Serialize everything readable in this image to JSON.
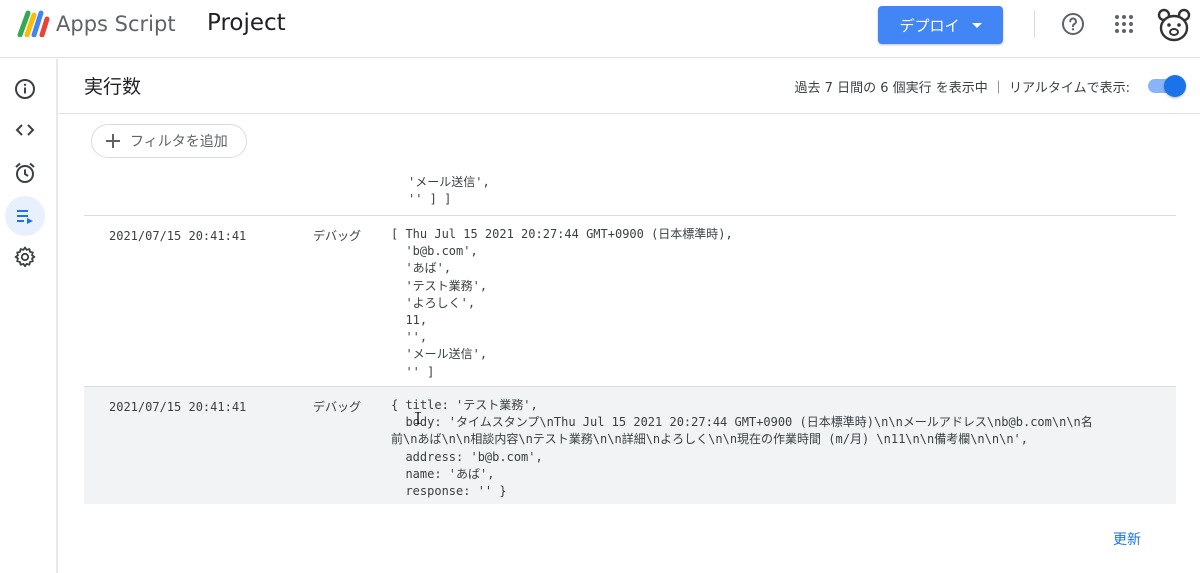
{
  "header": {
    "app_name": "Apps Script",
    "project_name": "Project",
    "deploy_label": "デプロイ",
    "icons": [
      "apps-script-logo",
      "help-icon",
      "apps-grid-icon",
      "account-avatar"
    ]
  },
  "sidebar": {
    "items": [
      {
        "name": "overview",
        "icon": "info-icon"
      },
      {
        "name": "editor",
        "icon": "code-icon"
      },
      {
        "name": "triggers",
        "icon": "alarm-clock-icon"
      },
      {
        "name": "executions",
        "icon": "executions-icon",
        "active": true
      },
      {
        "name": "settings",
        "icon": "gear-icon"
      }
    ]
  },
  "executions": {
    "title": "実行数",
    "summary": "過去 7 日間の 6 個実行 を表示中 ｜ リアルタイムで表示:",
    "realtime_on": true,
    "filter_label": "フィルタを追加",
    "refresh_label": "更新"
  },
  "logs": {
    "continuation": "'メール送信',\n'' ] ]",
    "entries": [
      {
        "time": "2021/07/15 20:41:41",
        "level": "デバッグ",
        "message": "[ Thu Jul 15 2021 20:27:44 GMT+0900 (日本標準時),\n  'b@b.com',\n  'あば',\n  'テスト業務',\n  'よろしく',\n  11,\n  '',\n  'メール送信',\n  '' ]"
      },
      {
        "time": "2021/07/15 20:41:41",
        "level": "デバッグ",
        "message": "{ title: 'テスト業務',\n  body: 'タイムスタンプ\\nThu Jul 15 2021 20:27:44 GMT+0900 (日本標準時)\\n\\nメールアドレス\\nb@b.com\\n\\n名\n前\\nあば\\n\\n相談内容\\nテスト業務\\n\\n詳細\\nよろしく\\n\\n現在の作業時間 (m/月) \\n11\\n\\n備考欄\\n\\n\\n',\n  address: 'b@b.com',\n  name: 'あば',\n  response: '' }"
      }
    ]
  }
}
